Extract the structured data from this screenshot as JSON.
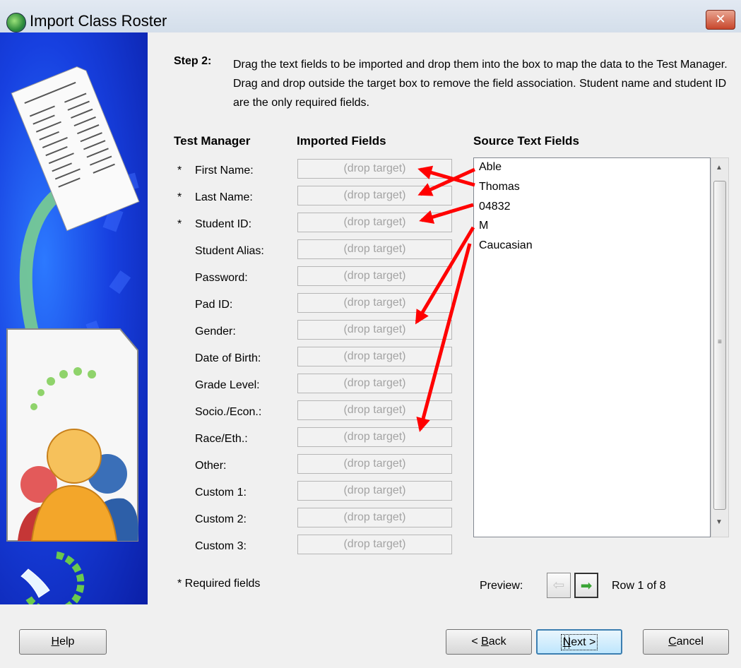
{
  "window": {
    "title": "Import Class Roster",
    "close_label": "✕"
  },
  "step": {
    "label": "Step 2:",
    "text": "Drag the text fields to be imported and drop them into the box to map the data to the Test Manager.  Drag and drop outside the target box to remove the field association.  Student name and student ID are the only required fields."
  },
  "headers": {
    "test_manager": "Test Manager",
    "imported": "Imported Fields",
    "source": "Source Text Fields"
  },
  "fields": [
    {
      "label": "First Name:",
      "required": true,
      "target": "(drop target)"
    },
    {
      "label": "Last Name:",
      "required": true,
      "target": "(drop target)"
    },
    {
      "label": "Student ID:",
      "required": true,
      "target": "(drop target)"
    },
    {
      "label": "Student Alias:",
      "required": false,
      "target": "(drop target)"
    },
    {
      "label": "Password:",
      "required": false,
      "target": "(drop target)"
    },
    {
      "label": "Pad ID:",
      "required": false,
      "target": "(drop target)"
    },
    {
      "label": "Gender:",
      "required": false,
      "target": "(drop target)"
    },
    {
      "label": "Date of Birth:",
      "required": false,
      "target": "(drop target)"
    },
    {
      "label": "Grade Level:",
      "required": false,
      "target": "(drop target)"
    },
    {
      "label": "Socio./Econ.:",
      "required": false,
      "target": "(drop target)"
    },
    {
      "label": "Race/Eth.:",
      "required": false,
      "target": "(drop target)"
    },
    {
      "label": "Other:",
      "required": false,
      "target": "(drop target)"
    },
    {
      "label": "Custom 1:",
      "required": false,
      "target": "(drop target)"
    },
    {
      "label": "Custom 2:",
      "required": false,
      "target": "(drop target)"
    },
    {
      "label": "Custom 3:",
      "required": false,
      "target": "(drop target)"
    }
  ],
  "required_marker": "*",
  "source_fields": [
    "Able",
    "Thomas",
    "04832",
    "M",
    "Caucasian"
  ],
  "required_note": "* Required fields",
  "preview": {
    "label": "Preview:",
    "row_info": "Row 1 of 8"
  },
  "buttons": {
    "help": {
      "prefix": "",
      "key": "H",
      "rest": "elp"
    },
    "back": {
      "prefix": "< ",
      "key": "B",
      "rest": "ack"
    },
    "next": {
      "prefix": "",
      "key": "N",
      "rest": "ext >"
    },
    "cancel": {
      "prefix": "",
      "key": "C",
      "rest": "ancel"
    }
  },
  "colors": {
    "banner_blue": "#1740e0",
    "arrow_red": "#ff0000",
    "green_arrow": "#3aa535"
  },
  "icons": [
    "app-icon",
    "close-icon",
    "roster-document-icon",
    "people-icon",
    "logo-icon",
    "preview-prev-icon",
    "preview-next-icon"
  ]
}
